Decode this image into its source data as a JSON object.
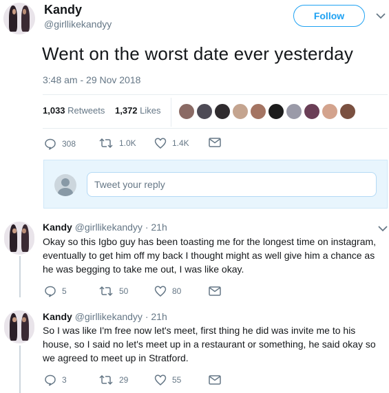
{
  "main_tweet": {
    "name": "Kandy",
    "handle": "@girllikekandyy",
    "follow_label": "Follow",
    "text": "Went on the worst date ever yesterday",
    "timestamp": "3:48 am - 29 Nov 2018",
    "retweets_count": "1,033",
    "retweets_label": "Retweets",
    "likes_count": "1,372",
    "likes_label": "Likes",
    "actions": {
      "replies": "308",
      "retweets": "1.0K",
      "likes": "1.4K"
    }
  },
  "reply_box": {
    "placeholder": "Tweet your reply"
  },
  "replies": [
    {
      "name": "Kandy",
      "handle": "@girllikekandyy",
      "time": "· 21h",
      "text": "Okay so this Igbo guy has been toasting me for the longest time on instagram, eventually to get him off my back I thought might as well give him a chance as he was begging to take me out, I was like okay.",
      "actions": {
        "replies": "5",
        "retweets": "50",
        "likes": "80"
      }
    },
    {
      "name": "Kandy",
      "handle": "@girllikekandyy",
      "time": "· 21h",
      "text": "So I was like I'm free now let's meet, first thing he did was invite me to his house, so I said no let's meet up in a restaurant or something, he said okay so we agreed to meet up in Stratford.",
      "actions": {
        "replies": "3",
        "retweets": "29",
        "likes": "55"
      }
    }
  ],
  "colors": {
    "accent": "#1da1f2",
    "secondary_text": "#657786",
    "divider": "#e6ecf0"
  },
  "liker_avatar_colors": [
    "#8a6a64",
    "#4d4a55",
    "#2f2b2e",
    "#c4a48f",
    "#a47462",
    "#1c1c1c",
    "#9a9aa8",
    "#6a3e56",
    "#d3a38d",
    "#7a5040"
  ]
}
